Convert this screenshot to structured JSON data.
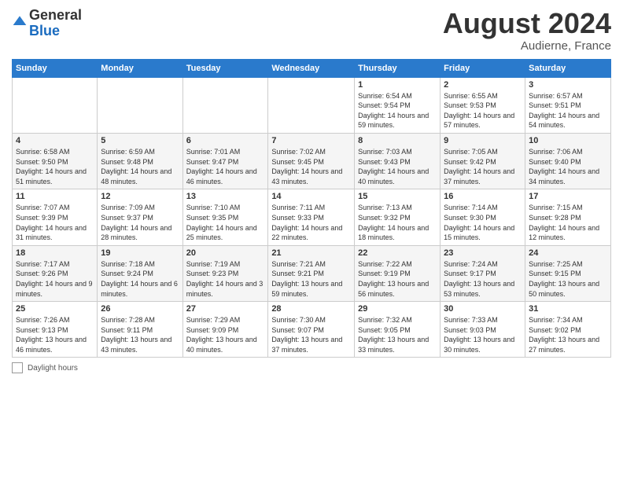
{
  "header": {
    "logo_general": "General",
    "logo_blue": "Blue",
    "month_year": "August 2024",
    "location": "Audierne, France"
  },
  "footer": {
    "label": "Daylight hours"
  },
  "days_of_week": [
    "Sunday",
    "Monday",
    "Tuesday",
    "Wednesday",
    "Thursday",
    "Friday",
    "Saturday"
  ],
  "weeks": [
    {
      "days": [
        {
          "number": "",
          "info": ""
        },
        {
          "number": "",
          "info": ""
        },
        {
          "number": "",
          "info": ""
        },
        {
          "number": "",
          "info": ""
        },
        {
          "number": "1",
          "info": "Sunrise: 6:54 AM\nSunset: 9:54 PM\nDaylight: 14 hours and 59 minutes."
        },
        {
          "number": "2",
          "info": "Sunrise: 6:55 AM\nSunset: 9:53 PM\nDaylight: 14 hours and 57 minutes."
        },
        {
          "number": "3",
          "info": "Sunrise: 6:57 AM\nSunset: 9:51 PM\nDaylight: 14 hours and 54 minutes."
        }
      ]
    },
    {
      "days": [
        {
          "number": "4",
          "info": "Sunrise: 6:58 AM\nSunset: 9:50 PM\nDaylight: 14 hours and 51 minutes."
        },
        {
          "number": "5",
          "info": "Sunrise: 6:59 AM\nSunset: 9:48 PM\nDaylight: 14 hours and 48 minutes."
        },
        {
          "number": "6",
          "info": "Sunrise: 7:01 AM\nSunset: 9:47 PM\nDaylight: 14 hours and 46 minutes."
        },
        {
          "number": "7",
          "info": "Sunrise: 7:02 AM\nSunset: 9:45 PM\nDaylight: 14 hours and 43 minutes."
        },
        {
          "number": "8",
          "info": "Sunrise: 7:03 AM\nSunset: 9:43 PM\nDaylight: 14 hours and 40 minutes."
        },
        {
          "number": "9",
          "info": "Sunrise: 7:05 AM\nSunset: 9:42 PM\nDaylight: 14 hours and 37 minutes."
        },
        {
          "number": "10",
          "info": "Sunrise: 7:06 AM\nSunset: 9:40 PM\nDaylight: 14 hours and 34 minutes."
        }
      ]
    },
    {
      "days": [
        {
          "number": "11",
          "info": "Sunrise: 7:07 AM\nSunset: 9:39 PM\nDaylight: 14 hours and 31 minutes."
        },
        {
          "number": "12",
          "info": "Sunrise: 7:09 AM\nSunset: 9:37 PM\nDaylight: 14 hours and 28 minutes."
        },
        {
          "number": "13",
          "info": "Sunrise: 7:10 AM\nSunset: 9:35 PM\nDaylight: 14 hours and 25 minutes."
        },
        {
          "number": "14",
          "info": "Sunrise: 7:11 AM\nSunset: 9:33 PM\nDaylight: 14 hours and 22 minutes."
        },
        {
          "number": "15",
          "info": "Sunrise: 7:13 AM\nSunset: 9:32 PM\nDaylight: 14 hours and 18 minutes."
        },
        {
          "number": "16",
          "info": "Sunrise: 7:14 AM\nSunset: 9:30 PM\nDaylight: 14 hours and 15 minutes."
        },
        {
          "number": "17",
          "info": "Sunrise: 7:15 AM\nSunset: 9:28 PM\nDaylight: 14 hours and 12 minutes."
        }
      ]
    },
    {
      "days": [
        {
          "number": "18",
          "info": "Sunrise: 7:17 AM\nSunset: 9:26 PM\nDaylight: 14 hours and 9 minutes."
        },
        {
          "number": "19",
          "info": "Sunrise: 7:18 AM\nSunset: 9:24 PM\nDaylight: 14 hours and 6 minutes."
        },
        {
          "number": "20",
          "info": "Sunrise: 7:19 AM\nSunset: 9:23 PM\nDaylight: 14 hours and 3 minutes."
        },
        {
          "number": "21",
          "info": "Sunrise: 7:21 AM\nSunset: 9:21 PM\nDaylight: 13 hours and 59 minutes."
        },
        {
          "number": "22",
          "info": "Sunrise: 7:22 AM\nSunset: 9:19 PM\nDaylight: 13 hours and 56 minutes."
        },
        {
          "number": "23",
          "info": "Sunrise: 7:24 AM\nSunset: 9:17 PM\nDaylight: 13 hours and 53 minutes."
        },
        {
          "number": "24",
          "info": "Sunrise: 7:25 AM\nSunset: 9:15 PM\nDaylight: 13 hours and 50 minutes."
        }
      ]
    },
    {
      "days": [
        {
          "number": "25",
          "info": "Sunrise: 7:26 AM\nSunset: 9:13 PM\nDaylight: 13 hours and 46 minutes."
        },
        {
          "number": "26",
          "info": "Sunrise: 7:28 AM\nSunset: 9:11 PM\nDaylight: 13 hours and 43 minutes."
        },
        {
          "number": "27",
          "info": "Sunrise: 7:29 AM\nSunset: 9:09 PM\nDaylight: 13 hours and 40 minutes."
        },
        {
          "number": "28",
          "info": "Sunrise: 7:30 AM\nSunset: 9:07 PM\nDaylight: 13 hours and 37 minutes."
        },
        {
          "number": "29",
          "info": "Sunrise: 7:32 AM\nSunset: 9:05 PM\nDaylight: 13 hours and 33 minutes."
        },
        {
          "number": "30",
          "info": "Sunrise: 7:33 AM\nSunset: 9:03 PM\nDaylight: 13 hours and 30 minutes."
        },
        {
          "number": "31",
          "info": "Sunrise: 7:34 AM\nSunset: 9:02 PM\nDaylight: 13 hours and 27 minutes."
        }
      ]
    }
  ]
}
